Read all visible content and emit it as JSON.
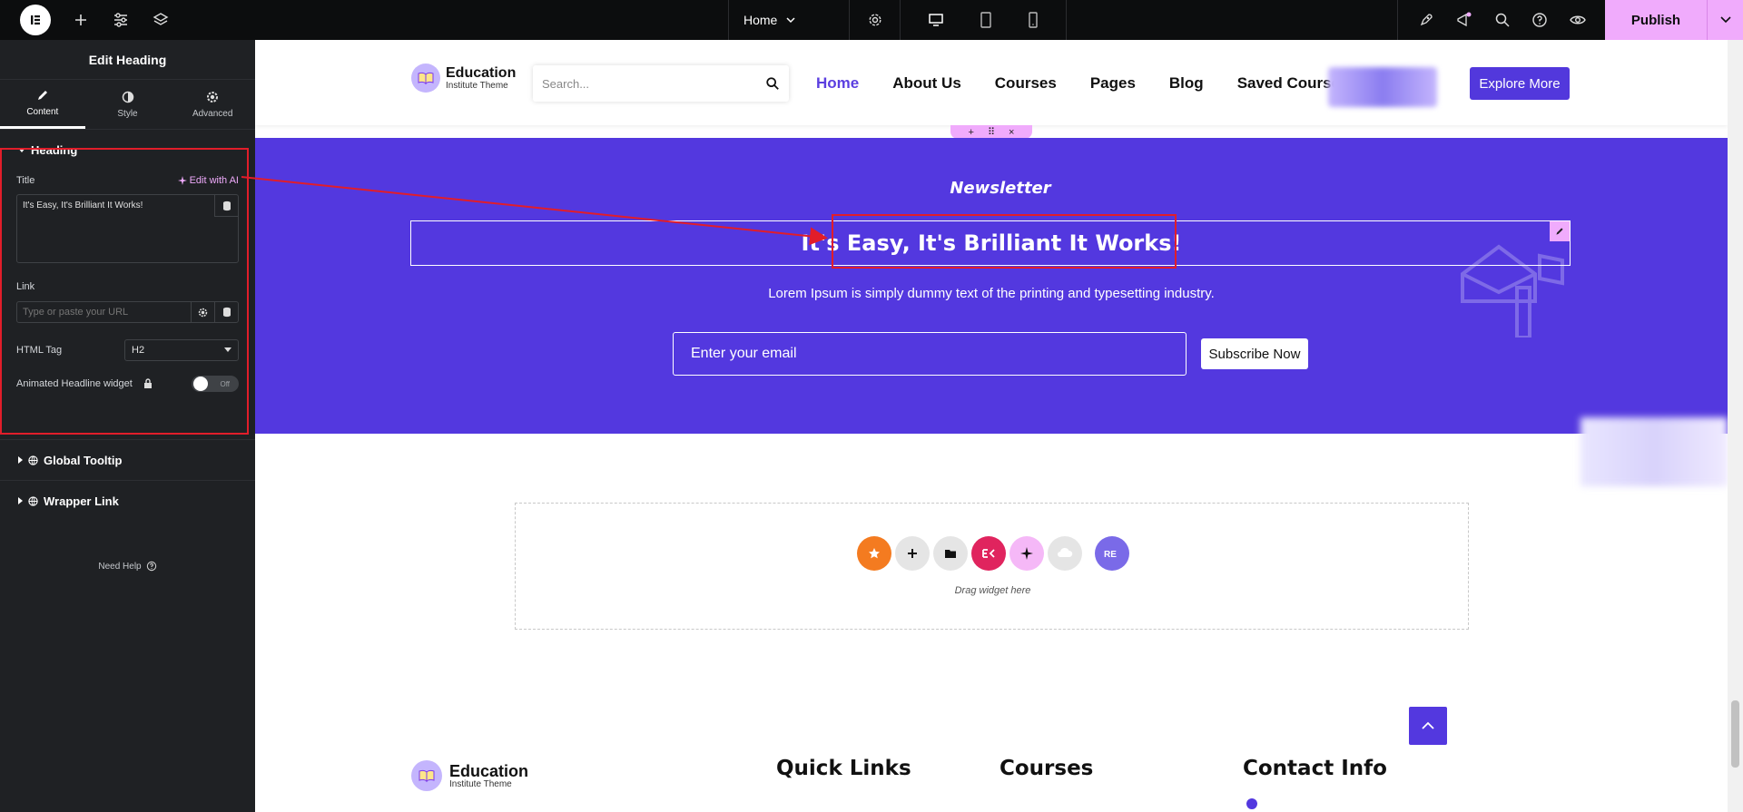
{
  "topbar": {
    "page_name": "Home",
    "publish_label": "Publish",
    "icons": [
      "elementor-logo-icon",
      "plus-icon",
      "sliders-icon",
      "layers-icon",
      "gear-icon",
      "desktop-icon",
      "tablet-icon",
      "mobile-icon",
      "rocket-icon",
      "megaphone-icon",
      "search-icon",
      "help-icon",
      "eye-icon",
      "chevron-down-icon"
    ]
  },
  "panel": {
    "header_title": "Edit Heading",
    "tabs": [
      {
        "label": "Content",
        "icon": "pencil-icon"
      },
      {
        "label": "Style",
        "icon": "half-circle-icon"
      },
      {
        "label": "Advanced",
        "icon": "gear-icon"
      }
    ],
    "section_heading": "Heading",
    "title_label": "Title",
    "edit_ai_label": "Edit with AI",
    "title_value": "It's Easy, It's Brilliant It Works!",
    "link_label": "Link",
    "link_placeholder": "Type or paste your URL",
    "html_tag_label": "HTML Tag",
    "html_tag_value": "H2",
    "animated_label": "Animated Headline widget",
    "toggle_state": "Off",
    "global_tooltip": "Global Tooltip",
    "wrapper_link": "Wrapper Link",
    "need_help": "Need Help"
  },
  "site": {
    "brand_name": "Education",
    "brand_sub": "Institute Theme",
    "search_placeholder": "Search...",
    "nav": [
      "Home",
      "About Us",
      "Courses",
      "Pages",
      "Blog",
      "Saved Courses"
    ],
    "explore_label": "Explore More",
    "newsletter_label": "Newsletter",
    "heading": "It's Easy, It's Brilliant It Works!",
    "description": "Lorem Ipsum is simply dummy text of the printing and typesetting industry.",
    "email_placeholder": "Enter your email",
    "subscribe_label": "Subscribe Now",
    "drag_text": "Drag widget here",
    "footer": {
      "brand_name": "Education",
      "brand_sub": "Institute Theme",
      "quick_links": "Quick Links",
      "courses": "Courses",
      "contact": "Contact Info"
    }
  },
  "colors": {
    "accent": "#5338df",
    "pink": "#f0abfc",
    "highlight": "#e11d2a",
    "panel_bg": "#1f2124"
  }
}
